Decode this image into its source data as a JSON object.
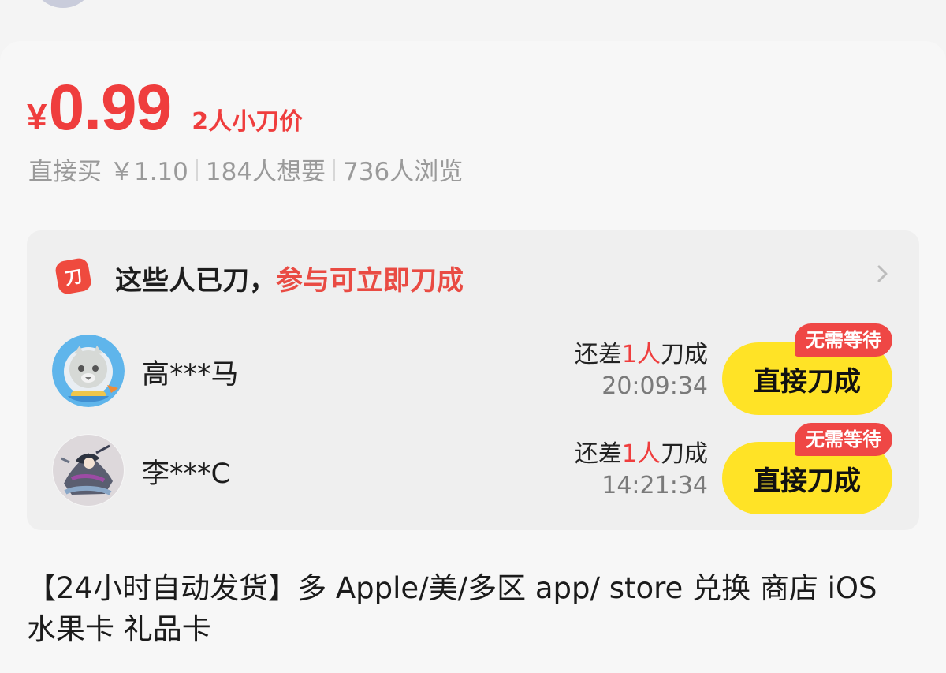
{
  "price": {
    "currency": "¥",
    "amount": "0.99",
    "note": "2人小刀价"
  },
  "meta": {
    "direct_buy": "直接买 ￥1.10",
    "wants": "184人想要",
    "views": "736人浏览"
  },
  "bargain": {
    "title_black": "这些人已刀，",
    "title_red": "参与可立即刀成",
    "rows": [
      {
        "name": "高***马",
        "status_prefix": "还差",
        "status_count": "1人",
        "status_suffix": "刀成",
        "time": "20:09:34",
        "button": "直接刀成",
        "badge": "无需等待"
      },
      {
        "name": "李***C",
        "status_prefix": "还差",
        "status_count": "1人",
        "status_suffix": "刀成",
        "time": "14:21:34",
        "button": "直接刀成",
        "badge": "无需等待"
      }
    ]
  },
  "description": {
    "text": "【24小时自动发货】多 Apple/美/多区 app/ store 兑换 商店 iOS 水果卡 礼品卡"
  },
  "colors": {
    "accent_red": "#ef3d3d",
    "button_yellow": "#ffe326",
    "badge_red": "#ef4745"
  }
}
